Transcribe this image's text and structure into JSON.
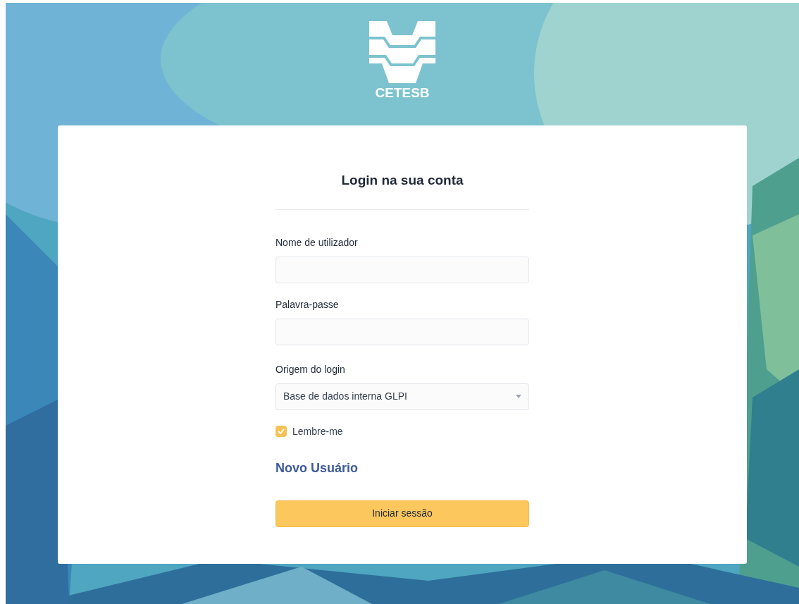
{
  "logo": {
    "text": "CETESB"
  },
  "title": "Login na sua conta",
  "fields": [
    {
      "kind": "text",
      "label": "Nome de utilizador"
    },
    {
      "kind": "password",
      "label": "Palavra-passe"
    },
    {
      "kind": "select",
      "label": "Origem do login",
      "value": "Base de dados interna GLPI"
    }
  ],
  "remember": {
    "label": "Lembre-me",
    "checked": true
  },
  "link": "Novo Usuário",
  "submit": "Iniciar sessão"
}
